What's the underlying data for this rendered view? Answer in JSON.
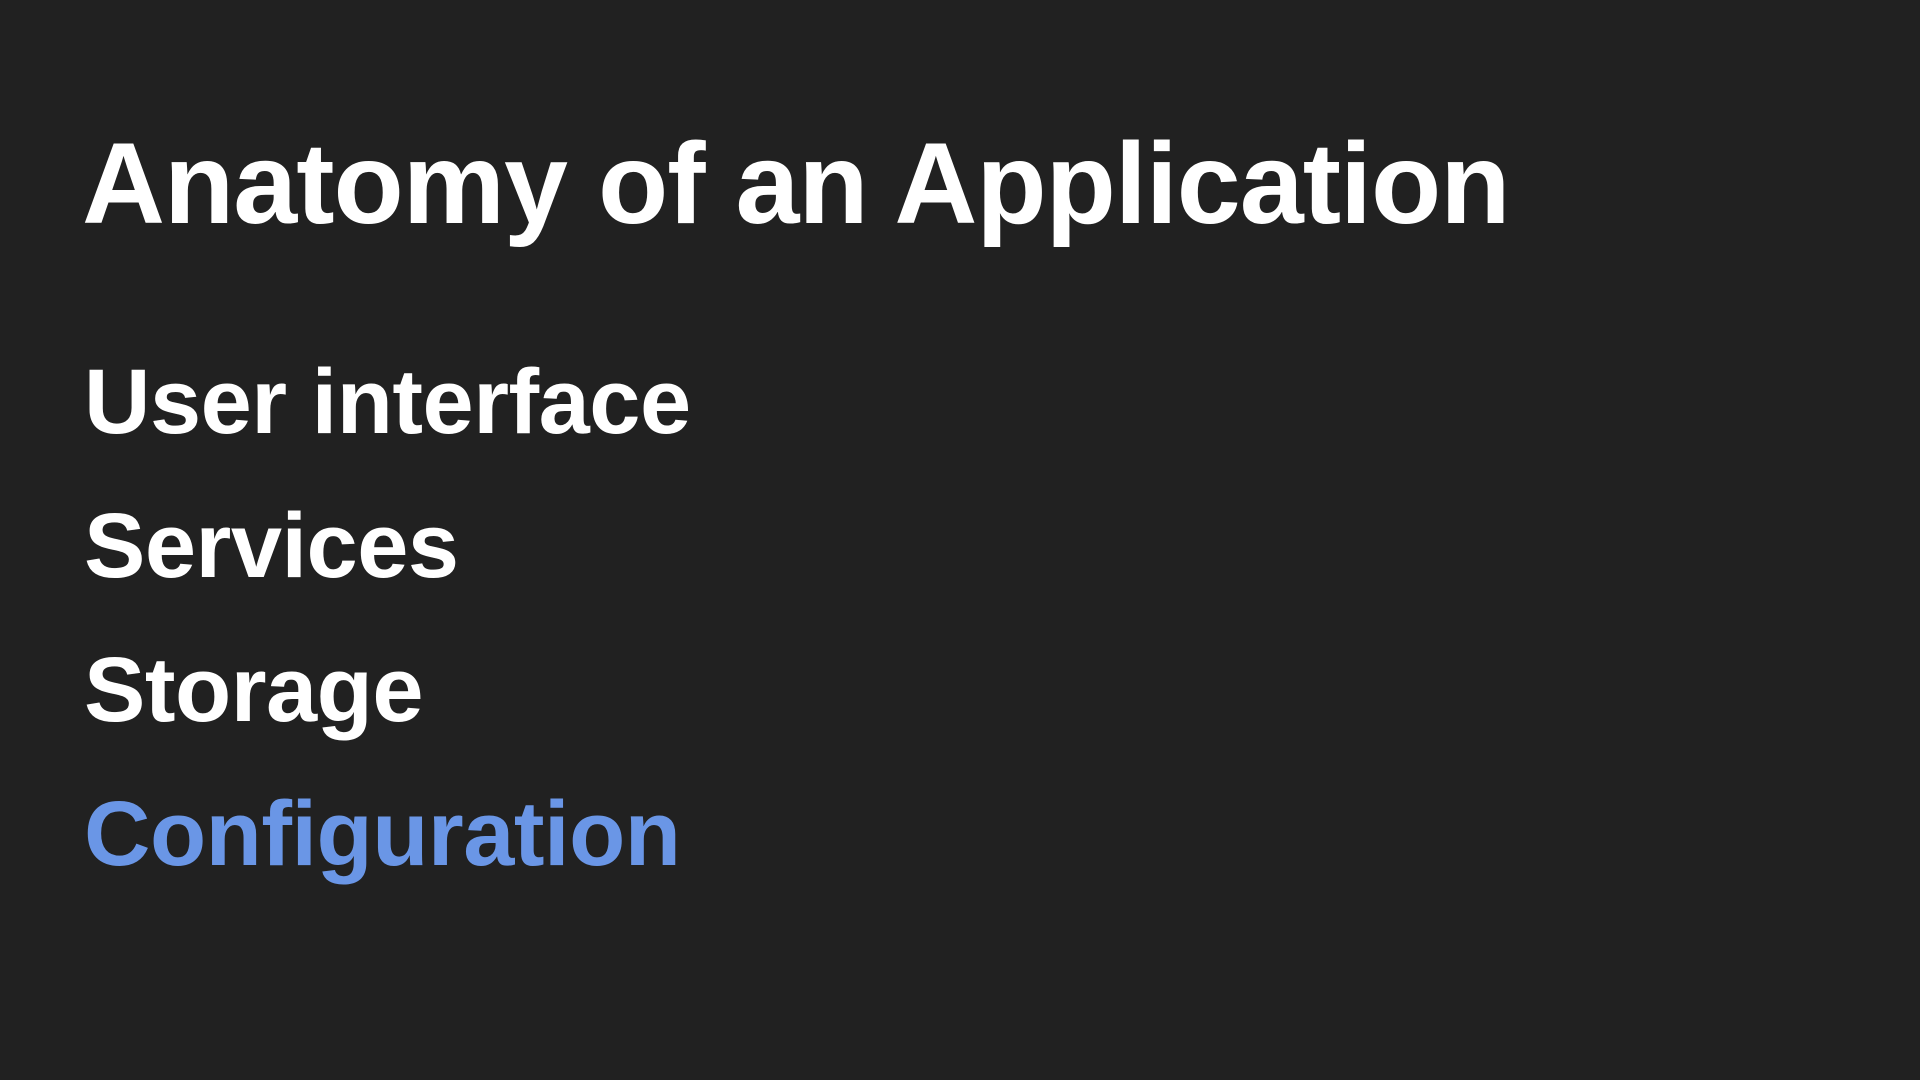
{
  "slide": {
    "title": "Anatomy of an Application",
    "items": [
      {
        "label": "User interface",
        "highlighted": false
      },
      {
        "label": "Services",
        "highlighted": false
      },
      {
        "label": "Storage",
        "highlighted": false
      },
      {
        "label": "Configuration",
        "highlighted": true
      }
    ]
  },
  "colors": {
    "background": "#212121",
    "text": "#ffffff",
    "accent": "#6a96e6"
  }
}
